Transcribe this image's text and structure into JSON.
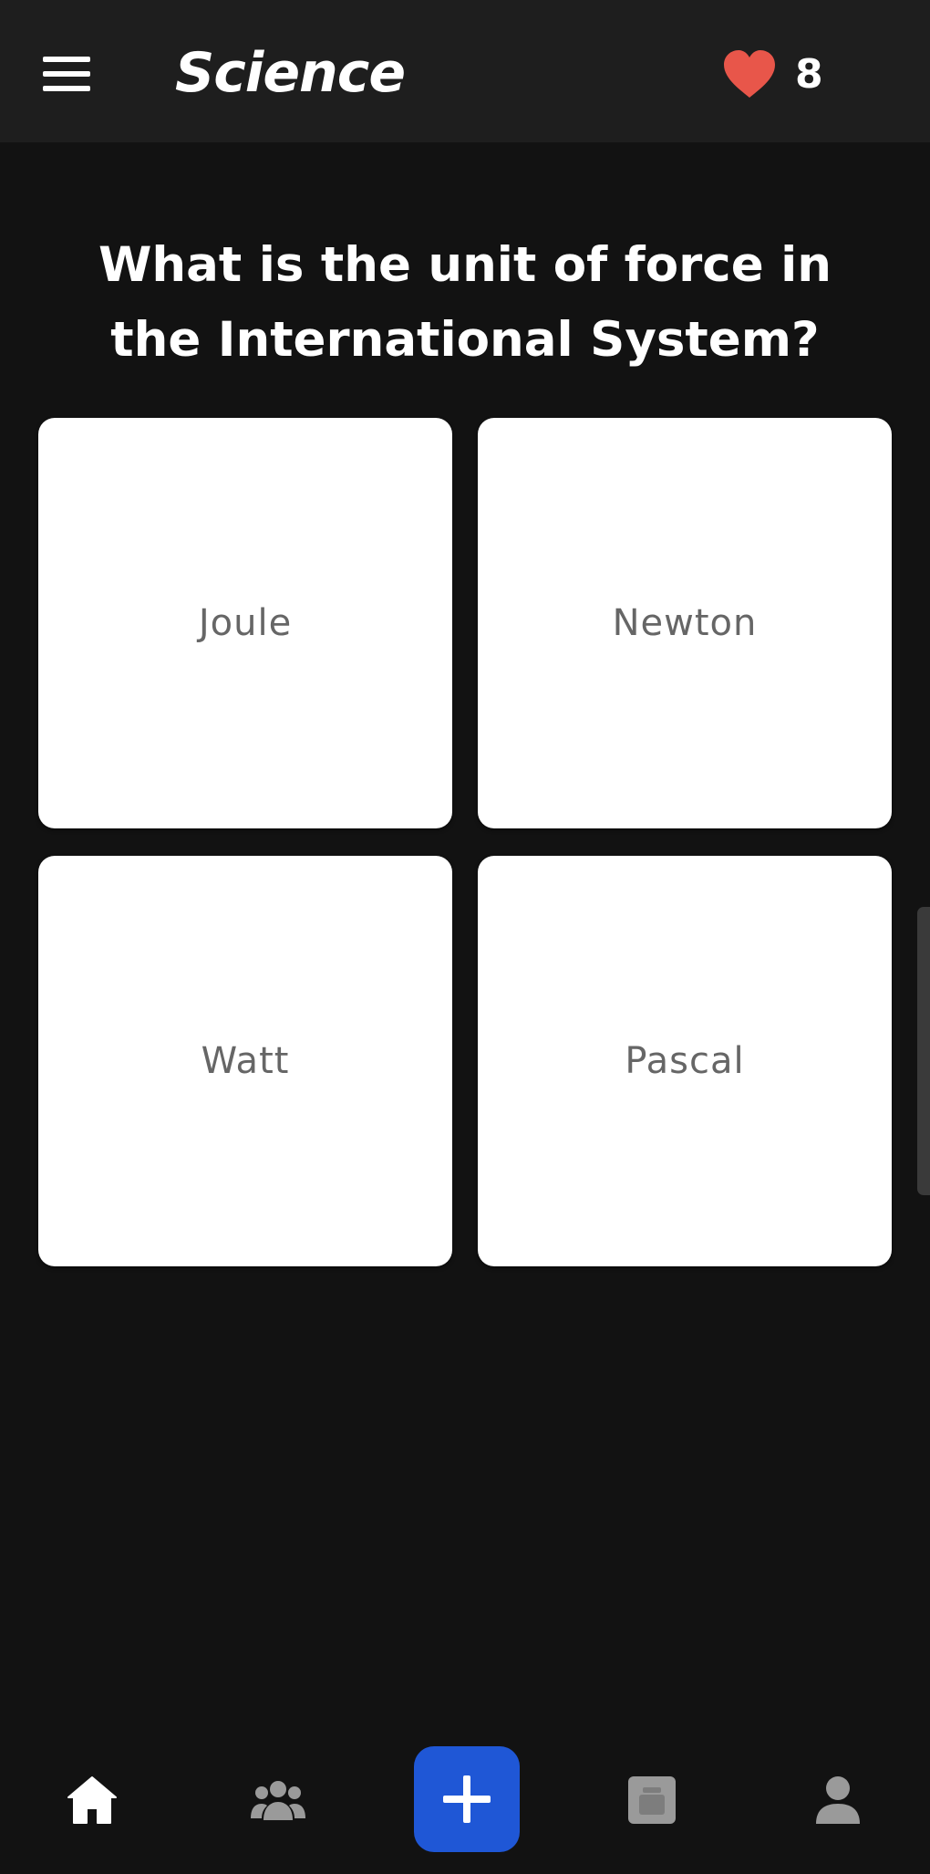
{
  "header": {
    "title": "Science",
    "lives": "8",
    "menu_icon": "hamburger-menu-icon",
    "lives_icon": "heart-icon",
    "lives_color": "#e8564a"
  },
  "question": {
    "text": "What is the unit of force in the International System?"
  },
  "answers": [
    {
      "label": "Joule"
    },
    {
      "label": "Newton"
    },
    {
      "label": "Watt"
    },
    {
      "label": "Pascal"
    }
  ],
  "bottom_nav": {
    "items": [
      {
        "icon": "home-icon"
      },
      {
        "icon": "group-icon"
      },
      {
        "icon": "add-icon"
      },
      {
        "icon": "library-icon"
      },
      {
        "icon": "profile-icon"
      }
    ],
    "accent": "#1f57d6"
  }
}
